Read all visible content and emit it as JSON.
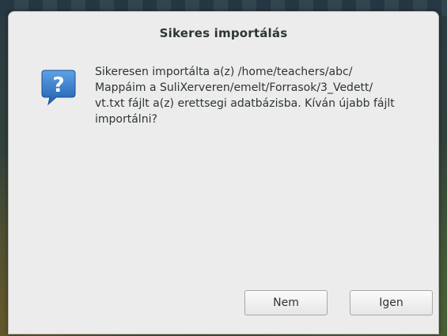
{
  "dialog": {
    "title": "Sikeres importálás",
    "icon": "question-icon",
    "message": "Sikeresen importálta a(z) /home/teachers/abc/\nMappáim a SuliXerveren/emelt/Forrasok/3_Vedett/\nvt.txt fájlt a(z) erettsegi adatbázisba. Kíván újabb fájlt\nimportálni?",
    "buttons": {
      "no_label": "Nem",
      "yes_label": "Igen"
    }
  },
  "colors": {
    "dialog_bg": "#ececec",
    "icon_blue": "#2a73c8",
    "text": "#2e3436"
  }
}
